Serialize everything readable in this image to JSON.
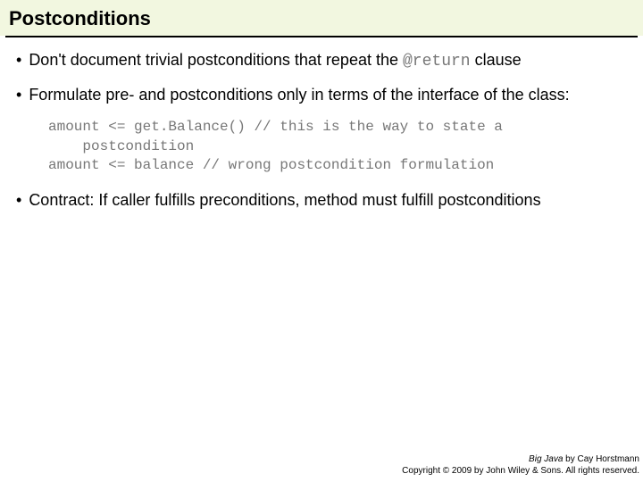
{
  "title": "Postconditions",
  "bullets": {
    "b1": {
      "pre": "Don't document trivial postconditions that repeat the ",
      "code": "@return",
      "post": " clause"
    },
    "b2": "Formulate pre- and postconditions only in terms of the interface of the class:",
    "b3": "Contract: If caller fulfills preconditions, method must fulfill postconditions"
  },
  "code": "amount <= get.Balance() // this is the way to state a\n    postcondition\namount <= balance // wrong postcondition formulation",
  "footer": {
    "book": "Big Java",
    "by": " by Cay Horstmann",
    "copyright": "Copyright © 2009 by John Wiley & Sons.  All rights reserved."
  }
}
